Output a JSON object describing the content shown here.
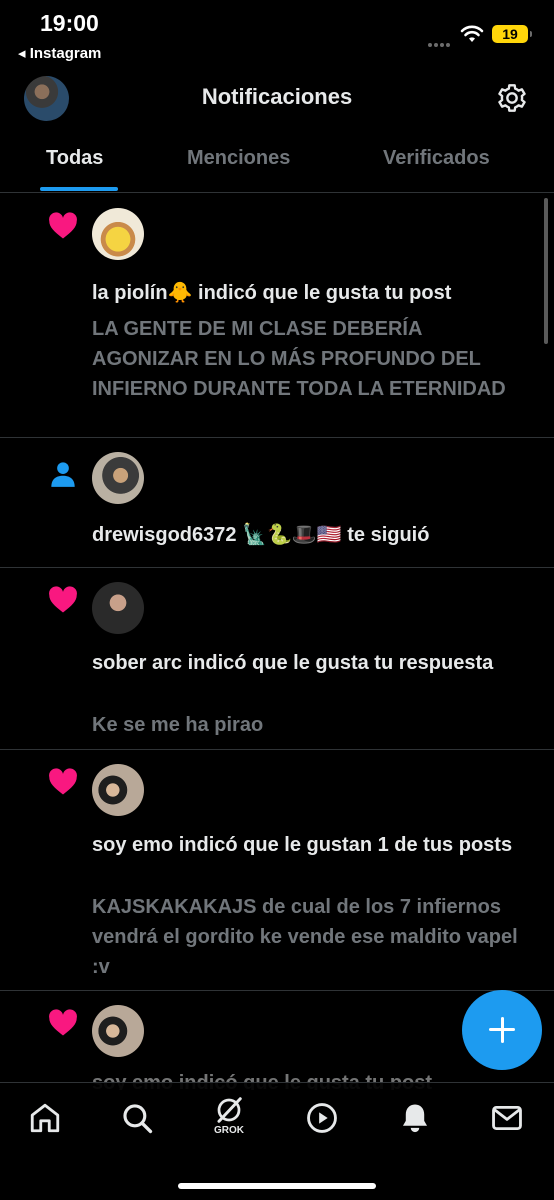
{
  "status_bar": {
    "time": "19:00",
    "back_app": "◂ Instagram",
    "battery": "19"
  },
  "header": {
    "title": "Notificaciones"
  },
  "tabs": [
    {
      "label": "Todas",
      "active": true
    },
    {
      "label": "Menciones",
      "active": false
    },
    {
      "label": "Verificados",
      "active": false
    }
  ],
  "notifications": [
    {
      "type": "like",
      "icon": "heart-icon",
      "title": "la piolín🐥 indicó que le gusta tu post",
      "body": "LA GENTE DE MI CLASE DEBERÍA AGONIZAR EN LO MÁS PROFUNDO DEL INFIERNO DURANTE TODA LA ETERNIDAD"
    },
    {
      "type": "follow",
      "icon": "person-icon",
      "title": "drewisgod6372 🗽🐍🎩🇺🇸 te siguió",
      "body": ""
    },
    {
      "type": "like",
      "icon": "heart-icon",
      "title": "sober arc indicó que le gusta tu respuesta",
      "body": "Ke se me ha pirao"
    },
    {
      "type": "like",
      "icon": "heart-icon",
      "title": "soy emo indicó que le gustan 1 de tus posts",
      "body": "KAJSKAKAKAJS de cual de los 7 infiernos vendrá el gordito ke vende ese maldito vapel :v"
    },
    {
      "type": "like",
      "icon": "heart-icon",
      "title": "soy emo indicó que le gusta tu post",
      "body": ""
    }
  ],
  "bottom_nav": {
    "grok_label": "GROK",
    "items": [
      "home-icon",
      "search-icon",
      "grok-icon",
      "play-icon",
      "bell-icon",
      "mail-icon"
    ]
  },
  "colors": {
    "accent": "#1d9bf0",
    "like": "#f91880",
    "muted": "#71767b",
    "text": "#e7e9ea"
  }
}
